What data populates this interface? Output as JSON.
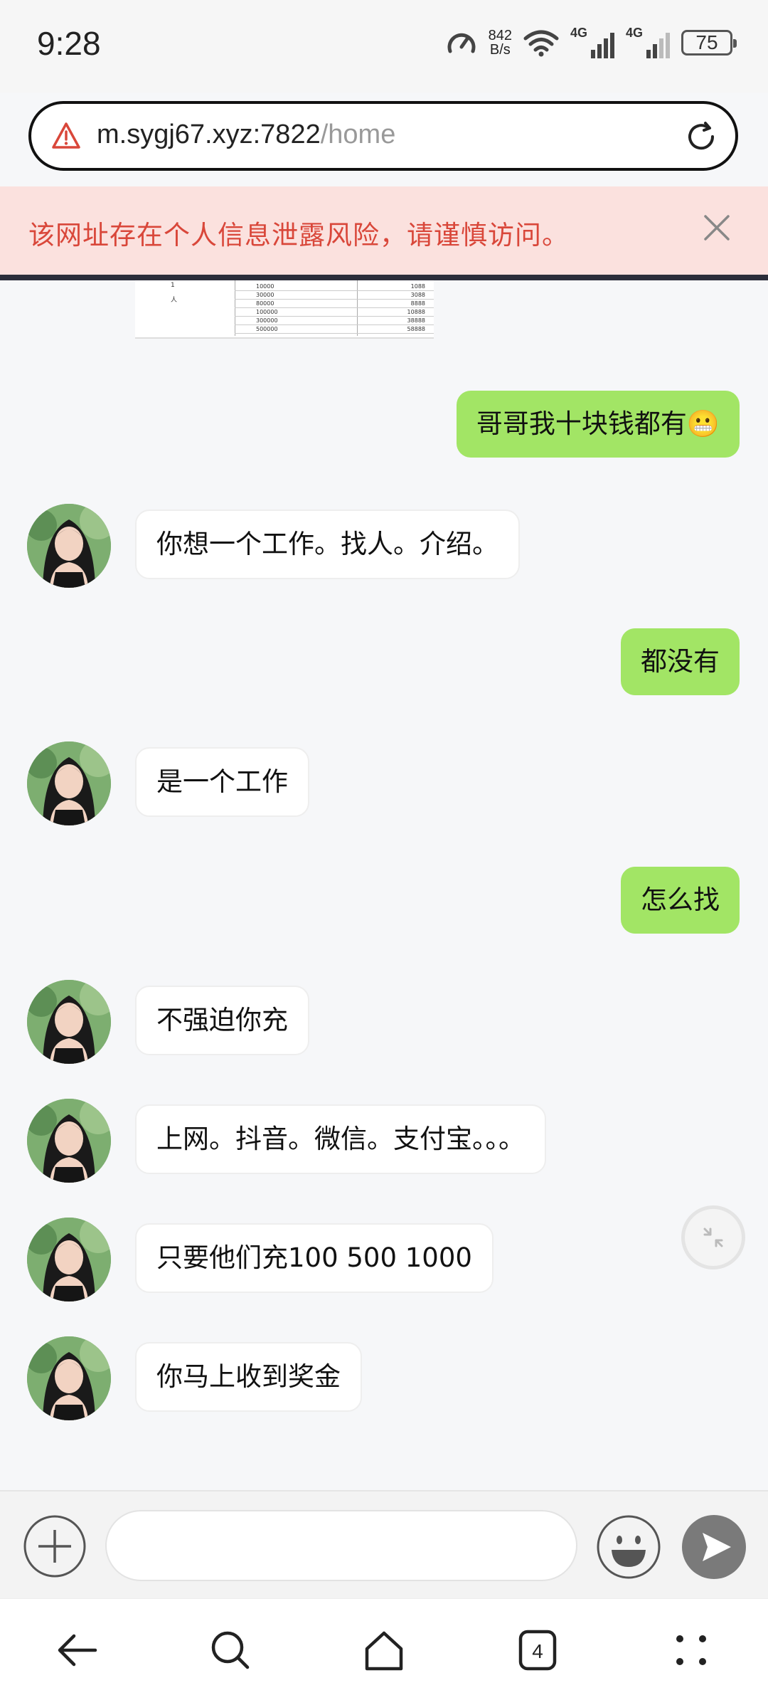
{
  "status_bar": {
    "time": "9:28",
    "net_speed_value": "842",
    "net_speed_unit": "B/s",
    "network_1": "4G",
    "network_2": "4G",
    "battery": "75"
  },
  "browser": {
    "url_host": "m.sygj67.xyz:7822",
    "url_path": "/home",
    "warning_text": "该网址存在个人信息泄露风险，请谨慎访问。",
    "tab_count": "4"
  },
  "chat": {
    "table_image": {
      "left_labels": [
        "1",
        "人"
      ],
      "rows": [
        [
          "10000",
          "1088"
        ],
        [
          "30000",
          "3088"
        ],
        [
          "80000",
          "8888"
        ],
        [
          "100000",
          "10888"
        ],
        [
          "300000",
          "38888"
        ],
        [
          "500000",
          "58888"
        ]
      ]
    },
    "messages": [
      {
        "side": "out",
        "text": "哥哥我十块钱都有😬"
      },
      {
        "side": "in",
        "text": "你想一个工作。找人。介绍。"
      },
      {
        "side": "out",
        "text": "都没有"
      },
      {
        "side": "in",
        "text": "是一个工作"
      },
      {
        "side": "out",
        "text": "怎么找"
      },
      {
        "side": "in",
        "text": "不强迫你充"
      },
      {
        "side": "in",
        "text": "上网。抖音。微信。支付宝。。。"
      },
      {
        "side": "in",
        "text": "只要他们充100 500 1000"
      },
      {
        "side": "in",
        "text": "你马上收到奖金"
      }
    ]
  },
  "input": {
    "value": "",
    "placeholder": ""
  },
  "icons": {
    "warning": "warning-triangle-icon",
    "reload": "reload-icon",
    "close": "close-icon",
    "add": "plus-circle-icon",
    "emoji": "emoji-icon",
    "send": "send-icon",
    "minimize": "minimize-icon",
    "back": "back-arrow-icon",
    "search": "search-icon",
    "home": "home-icon",
    "tabs": "tabs-icon",
    "menu": "menu-dots-icon"
  },
  "colors": {
    "outgoing_bubble": "#a2e565",
    "incoming_bubble": "#ffffff",
    "warning_bg": "#fbe1de",
    "warning_text": "#d9473a",
    "send_button": "#7a7a7a"
  }
}
